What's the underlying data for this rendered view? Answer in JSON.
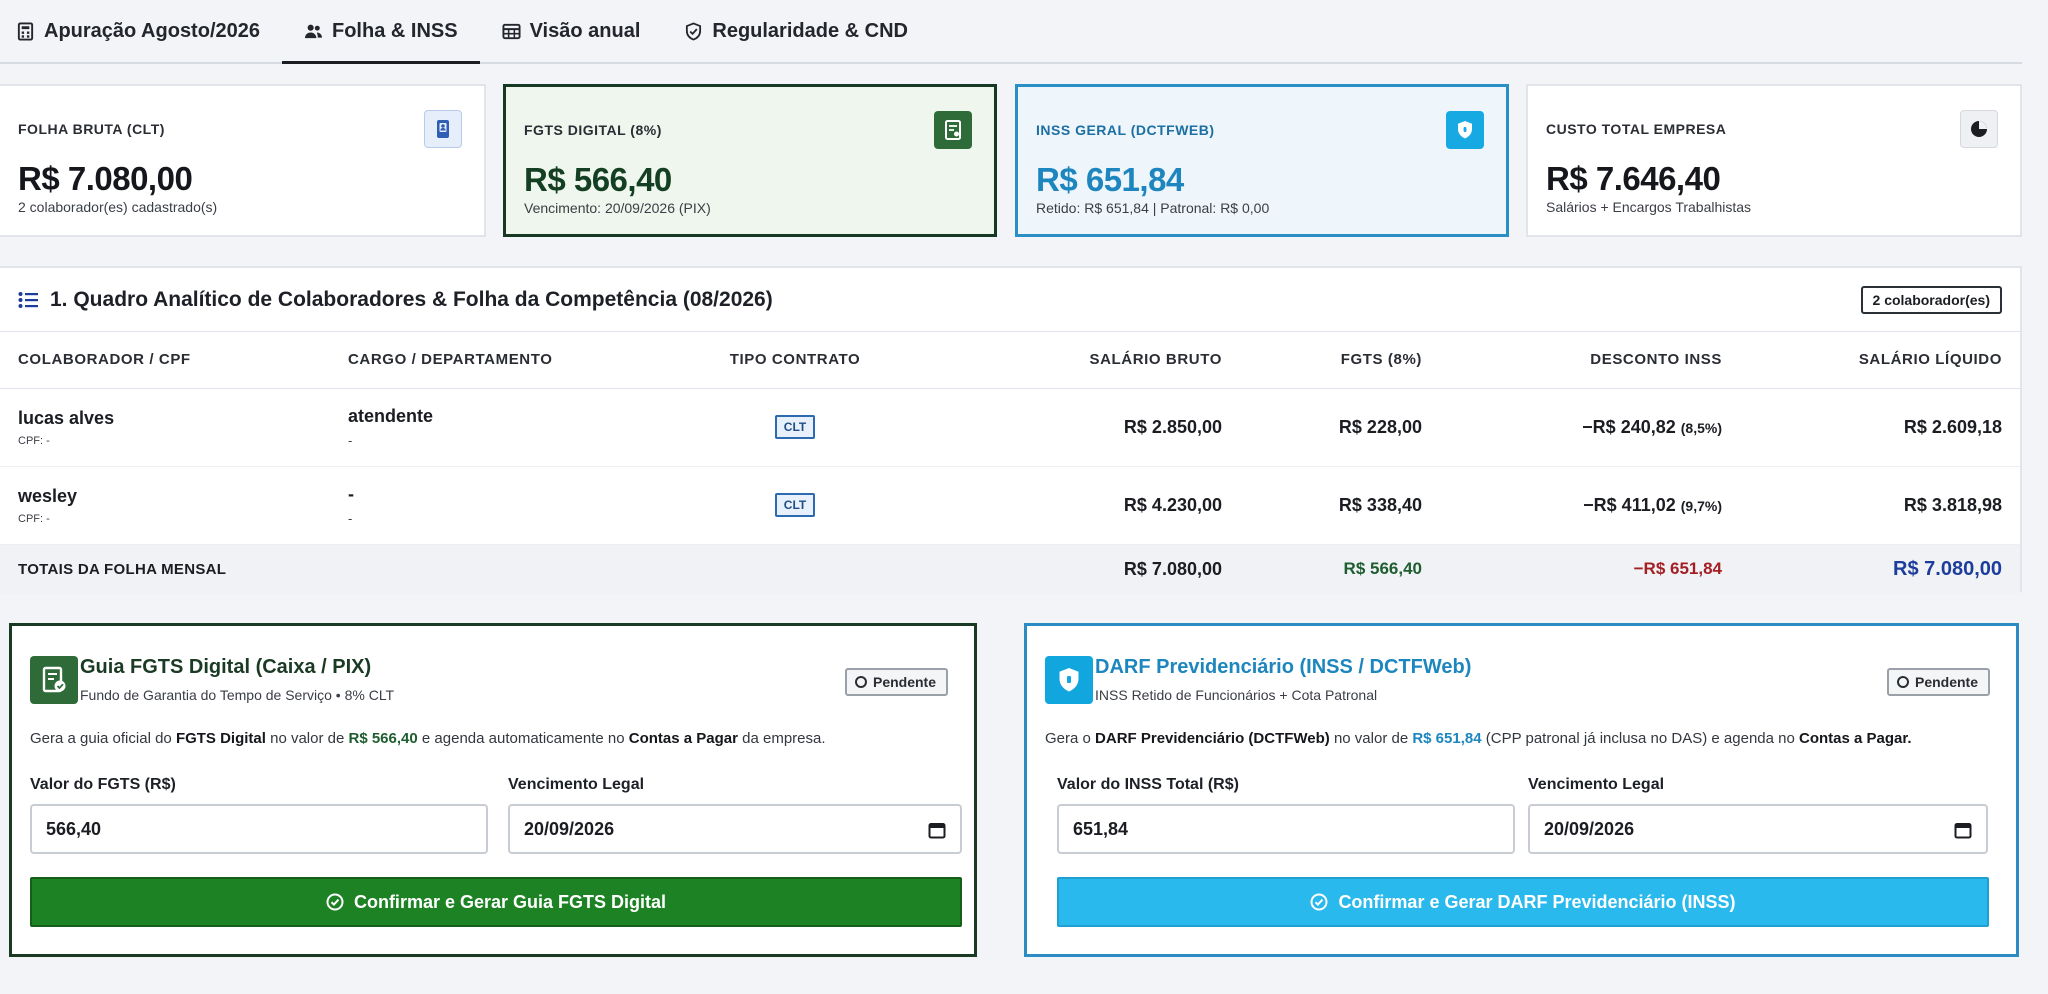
{
  "tabs": [
    {
      "label": "Apuração Agosto/2026",
      "icon": "calculator-icon"
    },
    {
      "label": "Folha & INSS",
      "icon": "users-icon"
    },
    {
      "label": "Visão anual",
      "icon": "calendar-grid-icon"
    },
    {
      "label": "Regularidade & CND",
      "icon": "shield-check-icon"
    }
  ],
  "active_tab": "Folha & INSS",
  "kpis": [
    {
      "label": "FOLHA BRUTA (CLT)",
      "value": "R$ 7.080,00",
      "sub": "2 colaborador(es) cadastrado(s)",
      "icon": "id-badge-icon"
    },
    {
      "label": "FGTS DIGITAL (8%)",
      "value": "R$ 566,40",
      "sub": "Vencimento: 20/09/2026 (PIX)",
      "icon": "receipt-icon"
    },
    {
      "label": "INSS GERAL (DCTFWEB)",
      "value": "R$ 651,84",
      "sub": "Retido: R$ 651,84 | Patronal: R$ 0,00",
      "icon": "shield-icon"
    },
    {
      "label": "CUSTO TOTAL EMPRESA",
      "value": "R$ 7.646,40",
      "sub": "Salários + Encargos Trabalhistas",
      "icon": "pie-chart-icon"
    }
  ],
  "table": {
    "title": "1. Quadro Analítico de Colaboradores & Folha da Competência (08/2026)",
    "count_badge": "2 colaborador(es)",
    "columns": [
      "COLABORADOR / CPF",
      "CARGO / DEPARTAMENTO",
      "TIPO CONTRATO",
      "SALÁRIO BRUTO",
      "FGTS (8%)",
      "DESCONTO INSS",
      "SALÁRIO LÍQUIDO"
    ],
    "rows": [
      {
        "name": "lucas alves",
        "cpf": "CPF: -",
        "cargo": "atendente",
        "departamento": "-",
        "tipo": "CLT",
        "bruto": "R$ 2.850,00",
        "fgts": "R$ 228,00",
        "inss": "−R$ 240,82",
        "inss_pct": "(8,5%)",
        "liquido": "R$ 2.609,18"
      },
      {
        "name": "wesley",
        "cpf": "CPF: -",
        "cargo": "-",
        "departamento": "-",
        "tipo": "CLT",
        "bruto": "R$ 4.230,00",
        "fgts": "R$ 338,40",
        "inss": "−R$ 411,02",
        "inss_pct": "(9,7%)",
        "liquido": "R$ 3.818,98"
      }
    ],
    "totals": {
      "label": "TOTAIS DA FOLHA MENSAL",
      "bruto": "R$ 7.080,00",
      "fgts": "R$ 566,40",
      "inss": "−R$ 651,84",
      "liquido": "R$ 7.080,00"
    }
  },
  "fgts_guide": {
    "title": "Guia FGTS Digital (Caixa / PIX)",
    "subtitle": "Fundo de Garantia do Tempo de Serviço • 8% CLT",
    "status": "Pendente",
    "desc_pre": "Gera a guia oficial do",
    "desc_b1": "FGTS Digital",
    "desc_mid": "no valor de",
    "desc_amount": "R$ 566,40",
    "desc_mid2": "e agenda automaticamente no",
    "desc_b2": "Contas a Pagar",
    "desc_post": "da empresa.",
    "amount_label": "Valor do FGTS (R$)",
    "amount_value": "566,40",
    "due_label": "Vencimento Legal",
    "due_value": "20/09/2026",
    "button": "Confirmar e Gerar Guia FGTS Digital",
    "colors": {
      "accent": "#1c8223",
      "border": "#1a3a23"
    }
  },
  "inss_guide": {
    "title": "DARF Previdenciário (INSS / DCTFWeb)",
    "subtitle": "INSS Retido de Funcionários + Cota Patronal",
    "status": "Pendente",
    "desc_pre": "Gera o",
    "desc_b1": "DARF Previdenciário (DCTFWeb)",
    "desc_mid": "no valor de",
    "desc_amount": "R$ 651,84",
    "desc_mid2": "(CPP patronal já inclusa no DAS) e agenda no",
    "desc_b2": "Contas a Pagar.",
    "amount_label": "Valor do INSS Total (R$)",
    "amount_value": "651,84",
    "due_label": "Vencimento Legal",
    "due_value": "20/09/2026",
    "button": "Confirmar e Gerar DARF Previdenciário (INSS)",
    "colors": {
      "accent": "#2ab9ec",
      "border": "#2b8bc2"
    }
  }
}
